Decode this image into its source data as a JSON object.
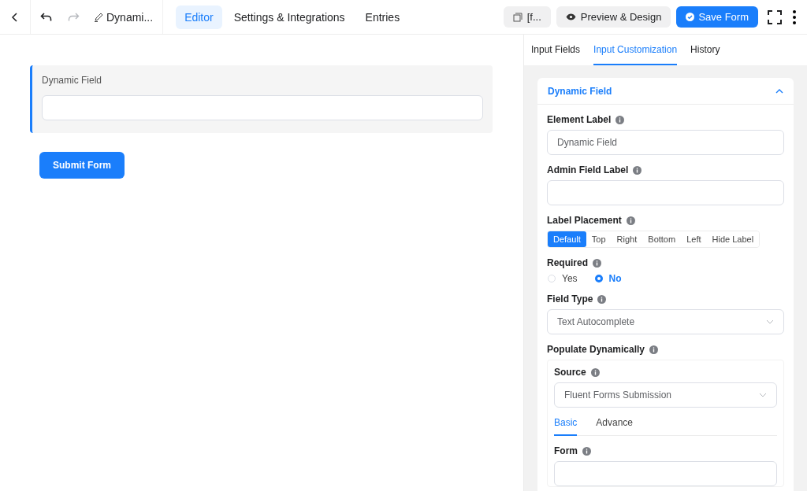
{
  "topbar": {
    "title": "Dynami...",
    "redo_disabled": true,
    "nav": [
      {
        "label": "Editor",
        "selected": true
      },
      {
        "label": "Settings & Integrations",
        "selected": false
      },
      {
        "label": "Entries",
        "selected": false
      }
    ],
    "shortcode": "[f...",
    "preview": "Preview & Design",
    "save": "Save Form"
  },
  "canvas": {
    "field_label": "Dynamic Field",
    "submit": "Submit Form"
  },
  "panel": {
    "tabs": [
      {
        "label": "Input Fields",
        "selected": false
      },
      {
        "label": "Input Customization",
        "selected": true
      },
      {
        "label": "History",
        "selected": false
      }
    ],
    "section": {
      "title": "Dynamic Field",
      "expanded": true,
      "settings": [
        {
          "kind": "text",
          "label": "Element Label",
          "value": "Dynamic Field"
        },
        {
          "kind": "text",
          "label": "Admin Field Label"
        },
        {
          "kind": "segmented",
          "label": "Label Placement",
          "options": [
            {
              "label": "Default",
              "selected": true
            },
            {
              "label": "Top",
              "selected": false
            },
            {
              "label": "Right",
              "selected": false
            },
            {
              "label": "Bottom",
              "selected": false
            },
            {
              "label": "Left",
              "selected": false
            },
            {
              "label": "Hide Label",
              "selected": false
            }
          ]
        },
        {
          "kind": "radio",
          "label": "Required",
          "options": [
            {
              "label": "Yes",
              "selected": false
            },
            {
              "label": "No",
              "selected": true
            }
          ]
        },
        {
          "kind": "select",
          "label": "Field Type",
          "value": "Text Autocomplete"
        },
        {
          "kind": "group",
          "label": "Populate Dynamically",
          "children": [
            {
              "kind": "select",
              "label": "Source",
              "value": "Fluent Forms Submission"
            },
            {
              "kind": "tabs",
              "options": [
                {
                  "label": "Basic",
                  "selected": true
                },
                {
                  "label": "Advance",
                  "selected": false
                }
              ]
            },
            {
              "kind": "text",
              "label": "Form"
            }
          ]
        }
      ]
    }
  }
}
